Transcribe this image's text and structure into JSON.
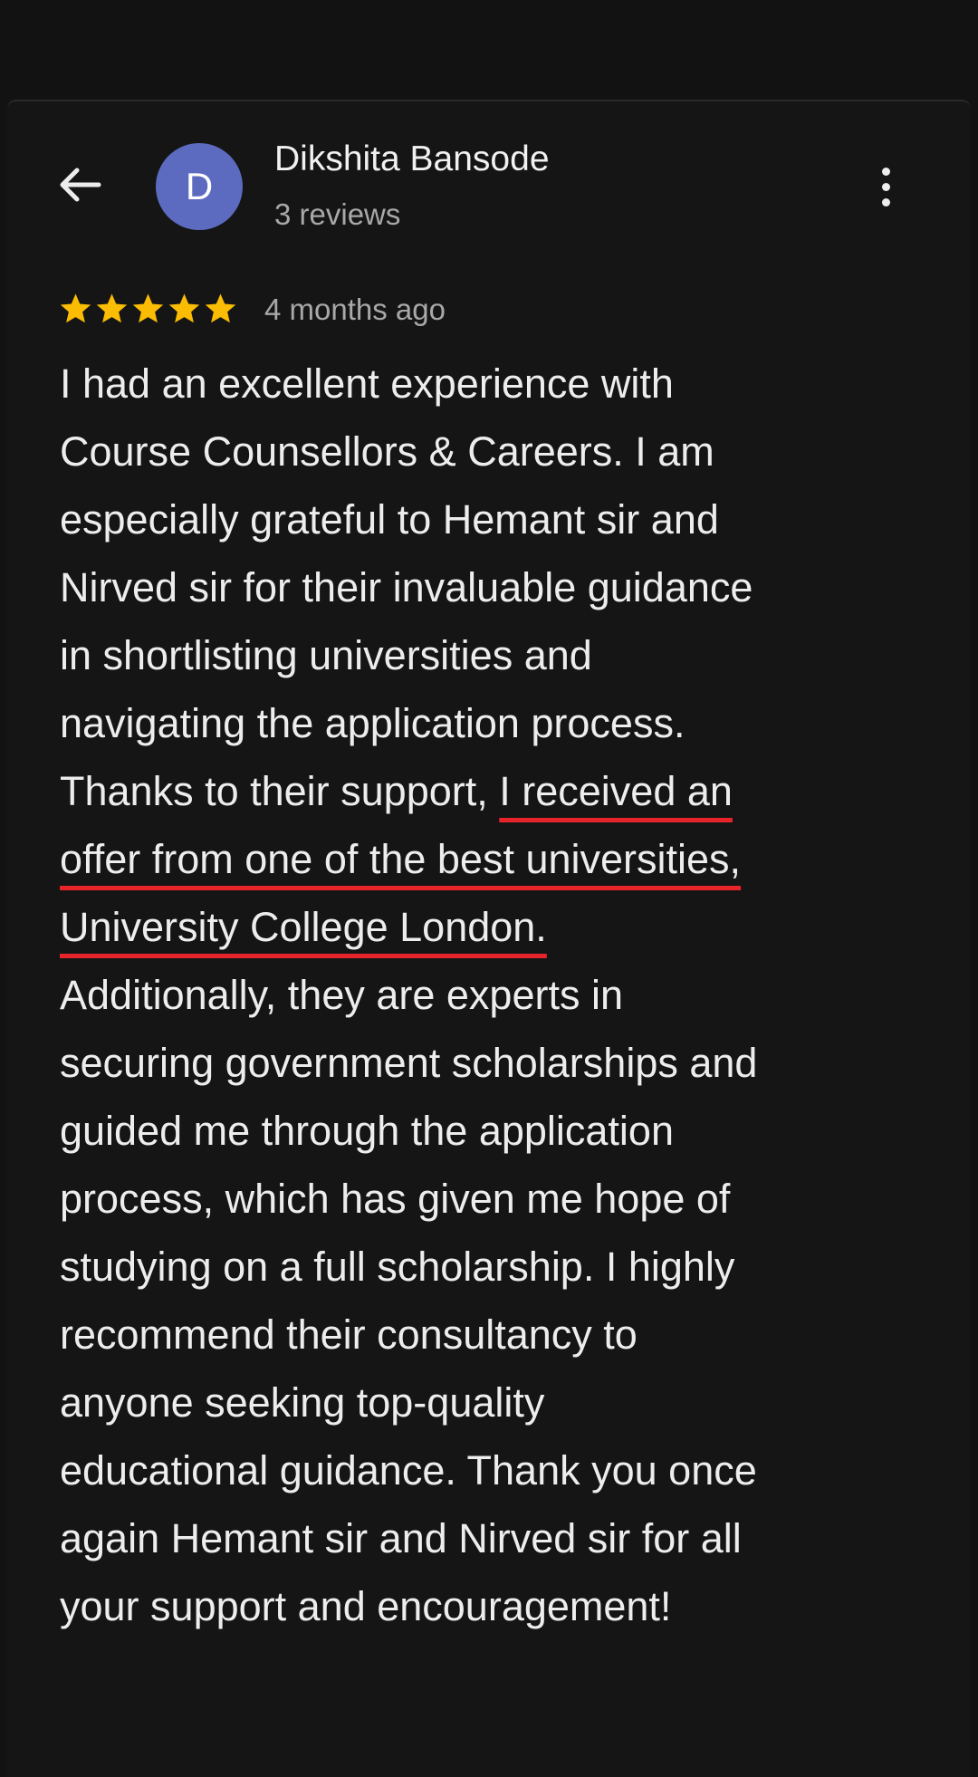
{
  "header": {
    "avatar_letter": "D",
    "reviewer_name": "Dikshita Bansode",
    "review_count": "3 reviews",
    "back_icon": "arrow-back-icon",
    "more_icon": "more-vert-icon"
  },
  "rating": {
    "stars": 5,
    "max_stars": 5,
    "time_ago": "4 months ago"
  },
  "review": {
    "lines": [
      "I had an excellent experience with",
      "Course Counsellors & Careers. I am",
      "especially grateful to Hemant sir and",
      "Nirved sir for their invaluable guidance",
      "in shortlisting universities and",
      "navigating the application process.",
      "Thanks to their support, ",
      "I received an",
      "offer from one of the best universities,",
      "University College London.",
      "Additionally, they are experts in",
      "securing government scholarships and",
      "guided me through the application",
      "process, which has given me hope of",
      "studying on a full scholarship. I highly",
      "recommend their consultancy to",
      "anyone seeking top-quality",
      "educational guidance. Thank you once",
      "again Hemant sir and Nirved sir for all",
      "your support and encouragement!"
    ]
  },
  "colors": {
    "background": "#121212",
    "avatar": "#5c6bc0",
    "star": "#fbbc04",
    "underline": "#e8242b",
    "text": "#ededed",
    "muted_text": "#a8a8a8"
  }
}
